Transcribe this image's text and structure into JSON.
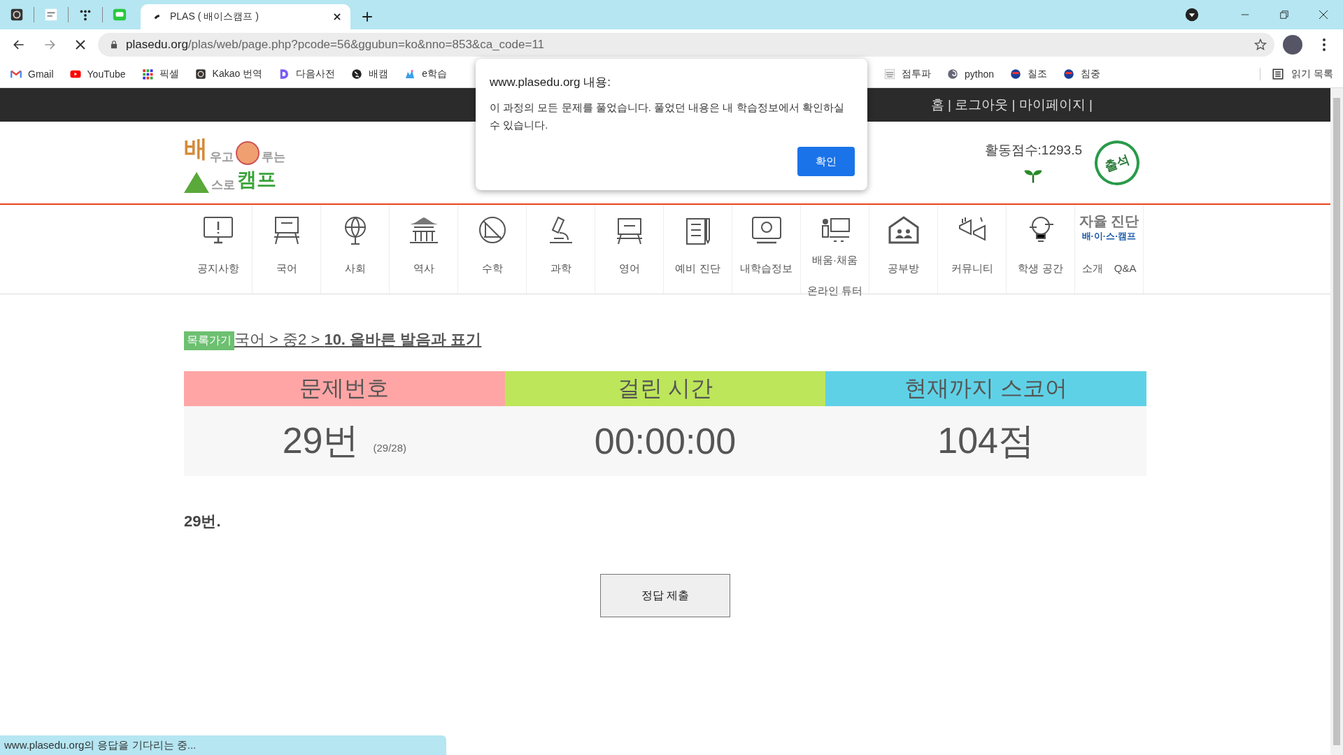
{
  "browser": {
    "tab_title": "PLAS ( 배이스캠프 )",
    "url_host": "plasedu.org",
    "url_path": "/plas/web/page.php?pcode=56&ggubun=ko&nno=853&ca_code=11",
    "bookmarks": [
      "Gmail",
      "YouTube",
      "픽셀",
      "Kakao 번역",
      "다음사전",
      "배캠",
      "e학습"
    ],
    "bookmarks_right": [
      "점투파",
      "python",
      "칠조",
      "침중"
    ],
    "reading_list": "읽기 목록",
    "status": "www.plasedu.org의 응답을 기다리는 중..."
  },
  "top_bar": {
    "links": "홈 | 로그아웃 | 마이페이지 |"
  },
  "header": {
    "logo": [
      [
        "배",
        "우고"
      ],
      [
        "루는"
      ],
      [
        "스로"
      ],
      [
        "캠프"
      ]
    ],
    "score": "활동점수:1293.5",
    "stamp": "출석"
  },
  "nav": [
    {
      "label": [
        "공지사항"
      ]
    },
    {
      "label": [
        "국어"
      ]
    },
    {
      "label": [
        "사회"
      ]
    },
    {
      "label": [
        "역사"
      ]
    },
    {
      "label": [
        "수학"
      ]
    },
    {
      "label": [
        "과학"
      ]
    },
    {
      "label": [
        "영어"
      ]
    },
    {
      "label": [
        "예비 진단"
      ]
    },
    {
      "label": [
        "내학습정보"
      ]
    },
    {
      "label": [
        "배움·채움",
        "온라인 튜터"
      ]
    },
    {
      "label": [
        "공부방"
      ]
    },
    {
      "label": [
        "커뮤니티"
      ]
    },
    {
      "label": [
        "학생 공간"
      ]
    },
    {
      "label": [
        "소개 Q&A"
      ],
      "badge": [
        "자율 진단",
        "배·이·스·캠프"
      ]
    }
  ],
  "breadcrumb": {
    "tag": "목록가기",
    "path": "국어 > 중2 > **10. 올바른 발음과 표기**"
  },
  "scoreboard": [
    {
      "heading": "문제번호",
      "color": "#ffa5a5",
      "value": "29번",
      "note": "(29/28)"
    },
    {
      "heading": "걸린 시간",
      "color": "#bde65a",
      "value": "00:00:00"
    },
    {
      "heading": "현재까지 스코어",
      "color": "#5fd1e6",
      "value": "104점"
    }
  ],
  "question": "29번.",
  "submit": "정답 제출",
  "dialog": {
    "title": "www.plasedu.org 내용:",
    "message": "이 과정의 모든 문제를 풀었습니다. 풀었던 내용은 내 학습정보에서 확인하실 수 있습니다.",
    "ok": "확인"
  }
}
